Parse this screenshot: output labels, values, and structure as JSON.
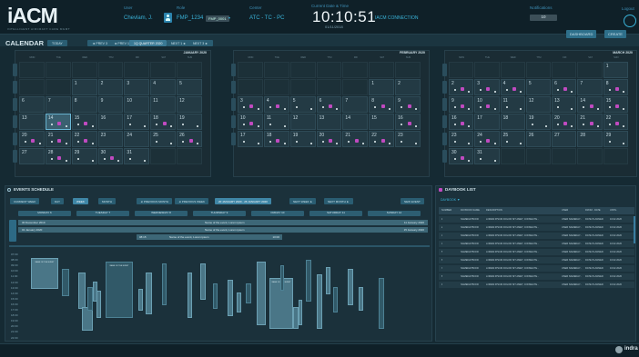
{
  "header": {
    "logo": "iACM",
    "logo_sub": "INTELLIGENT AIRCRAFT CARE MGMT",
    "user_label": "User",
    "user_value": "Chevlam, J.",
    "role_label": "Role",
    "role_value": "FMP_1234",
    "role_badge": "FMP_0001",
    "center_label": "Center",
    "center_value": "ATC - TC - PC",
    "time_label": "Current Date & Time",
    "time_value": "10:10:51",
    "date_value": "01/11/2018",
    "connection": "IACM CONNECTION",
    "notif_label": "Notifications",
    "notif_value": "10",
    "logout_label": "Logout"
  },
  "toolbar": {
    "btn1": "DASHBOARD",
    "btn2": "CREATE"
  },
  "calendar": {
    "title": "CALENDAR",
    "today_btn": "TODAY",
    "nav": [
      "◄ PREV 3",
      "◄ PREV 1",
      "1Q QUARTER 2020",
      "NEXT 1 ►",
      "NEXT 3 ►"
    ],
    "days": [
      "MON",
      "TUE",
      "WED",
      "THU",
      "FRI",
      "SAT",
      "SUN"
    ],
    "months": [
      "JANUARY 2020",
      "FEBRUARY 2020",
      "MARCH 2020"
    ]
  },
  "events": {
    "title": "EVENTS SCHEDULE",
    "current_week": "CURRENT WEEK",
    "tabs": [
      "DAY",
      "WEEK",
      "MONTH"
    ],
    "prev_month": "◄ PREVIOUS MONTH",
    "prev_week": "◄ PREVIOUS WEEK",
    "range": "20 JANUARY 2020 - 26 JANUARY 2020",
    "next_week": "NEXT WEEK ►",
    "next_month": "NEXT MONTH ►",
    "new_event": "NEW EVENT",
    "weekdays": [
      "MONDAY 6",
      "TUESDAY 7",
      "WEDNESDAY 8",
      "THURSDAY 9",
      "FRIDAY 10",
      "SATURDAY 11",
      "SUNDAY 12"
    ],
    "rows": [
      {
        "start": "30 December 2019",
        "name": "Name of the event, Lorem ipsum",
        "end": "11 January 2020"
      },
      {
        "start": "01 January 2020",
        "name": "Name of the event, Lorem ipsum",
        "end": "15 January 2020"
      },
      {
        "start": "08:15",
        "name": "Name of the event, Lorem ipsum",
        "end": "10:00"
      }
    ],
    "times": [
      "07:00",
      "08:00",
      "09:00",
      "10:00",
      "11:00",
      "12:00",
      "13:00",
      "14:00",
      "15:00",
      "16:00",
      "17:00",
      "18:00",
      "19:00",
      "20:00",
      "21:00",
      "22:00"
    ],
    "block_label": "NAME OF THE EVENT"
  },
  "list": {
    "title": "DAYBOOK LIST",
    "filter": "DAYBOOK ▼",
    "cols": [
      "NUMBER",
      "DAYBOOK NAME",
      "DESCRIPTION",
      "USER",
      "FROM - DATE",
      "UNTIL"
    ],
    "rows": [
      [
        "1",
        "NAMEDAYBOOK",
        "LOREM IPSUM DOLOR SIT AMET, CONSECTE...",
        "USER NAMEDAY...",
        "DATE PLANNED",
        "16.02.2020"
      ],
      [
        "2",
        "NAMEDAYBOOK",
        "LOREM IPSUM DOLOR SIT AMET, CONSECTE...",
        "USER NAMEDAY...",
        "DATE PLANNED",
        "16.02.2020"
      ],
      [
        "3",
        "NAMEDAYBOOK",
        "LOREM IPSUM DOLOR SIT AMET, CONSECTE...",
        "USER NAMEDAY...",
        "DATE PLANNED",
        "16.02.2020"
      ],
      [
        "4",
        "NAMEDAYBOOK",
        "LOREM IPSUM DOLOR SIT AMET, CONSECTE...",
        "USER NAMEDAY...",
        "DATE PLANNED",
        "16.02.2020"
      ],
      [
        "5",
        "NAMEDAYBOOK",
        "LOREM IPSUM DOLOR SIT AMET, CONSECTE...",
        "USER NAMEDAY...",
        "DATE PLANNED",
        "16.02.2020"
      ],
      [
        "6",
        "NAMEDAYBOOK",
        "LOREM IPSUM DOLOR SIT AMET, CONSECTE...",
        "USER NAMEDAY...",
        "DATE PLANNED",
        "16.02.2020"
      ],
      [
        "7",
        "NAMEDAYBOOK",
        "LOREM IPSUM DOLOR SIT AMET, CONSECTE...",
        "USER NAMEDAY...",
        "DATE PLANNED",
        "16.02.2020"
      ],
      [
        "8",
        "NAMEDAYBOOK",
        "LOREM IPSUM DOLOR SIT AMET, CONSECTE...",
        "USER NAMEDAY...",
        "DATE PLANNED",
        "16.02.2020"
      ],
      [
        "9",
        "NAMEDAYBOOK",
        "LOREM IPSUM DOLOR SIT AMET, CONSECTE...",
        "USER NAMEDAY...",
        "DATE PLANNED",
        "16.02.2020"
      ]
    ]
  },
  "footer": {
    "brand": "indra"
  }
}
